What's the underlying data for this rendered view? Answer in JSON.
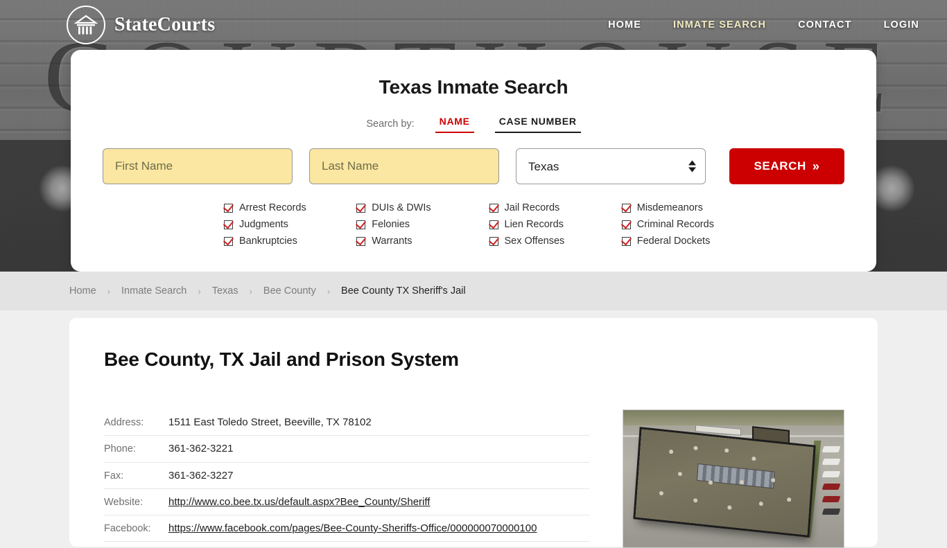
{
  "brand": {
    "name": "StateCourts",
    "icon": "courthouse-icon"
  },
  "nav": {
    "items": [
      {
        "label": "HOME",
        "active": false
      },
      {
        "label": "INMATE SEARCH",
        "active": true
      },
      {
        "label": "CONTACT",
        "active": false
      },
      {
        "label": "LOGIN",
        "active": false
      }
    ]
  },
  "hero": {
    "background_word": "COURTHOUSE"
  },
  "search": {
    "title": "Texas Inmate Search",
    "search_by_label": "Search by:",
    "tabs": [
      {
        "label": "NAME",
        "active": true
      },
      {
        "label": "CASE NUMBER",
        "active": false
      }
    ],
    "first_name": {
      "value": "",
      "placeholder": "First Name"
    },
    "last_name": {
      "value": "",
      "placeholder": "Last Name"
    },
    "state": {
      "selected": "Texas",
      "options": [
        "Texas"
      ]
    },
    "button": {
      "label": "SEARCH",
      "chevron": "»",
      "color": "#cc0000"
    },
    "record_types": [
      "Arrest Records",
      "DUIs & DWIs",
      "Jail Records",
      "Misdemeanors",
      "Judgments",
      "Felonies",
      "Lien Records",
      "Criminal Records",
      "Bankruptcies",
      "Warrants",
      "Sex Offenses",
      "Federal Dockets"
    ]
  },
  "breadcrumb": {
    "separator": "›",
    "items": [
      {
        "label": "Home",
        "current": false
      },
      {
        "label": "Inmate Search",
        "current": false
      },
      {
        "label": "Texas",
        "current": false
      },
      {
        "label": "Bee County",
        "current": false
      },
      {
        "label": "Bee County TX Sheriff's Jail",
        "current": true
      }
    ]
  },
  "page": {
    "title": "Bee County, TX Jail and Prison System",
    "details": [
      {
        "key": "Address:",
        "value": "1511 East Toledo Street, Beeville, TX 78102",
        "link": false
      },
      {
        "key": "Phone:",
        "value": "361-362-3221",
        "link": false
      },
      {
        "key": "Fax:",
        "value": "361-362-3227",
        "link": false
      },
      {
        "key": "Website:",
        "value": "http://www.co.bee.tx.us/default.aspx?Bee_County/Sheriff",
        "link": true
      },
      {
        "key": "Facebook:",
        "value": "https://www.facebook.com/pages/Bee-County-Sheriffs-Office/000000070000100",
        "link": true
      }
    ],
    "photo_alt": "Aerial satellite view of Bee County TX Sheriff's Jail"
  }
}
